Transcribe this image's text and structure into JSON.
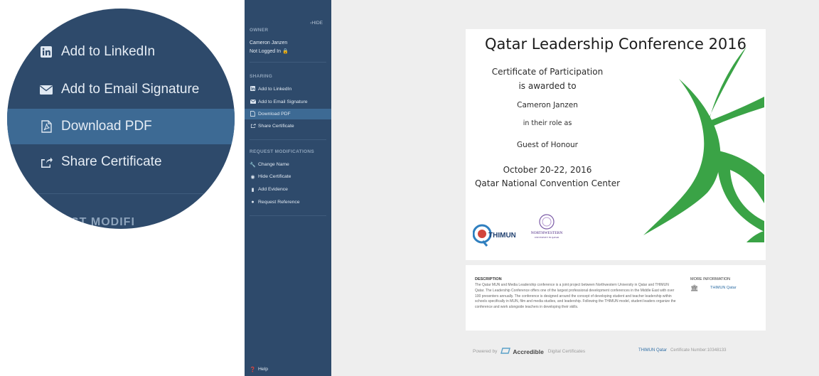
{
  "zoom": {
    "items": [
      {
        "label": "Add to LinkedIn",
        "icon": "linkedin-icon"
      },
      {
        "label": "Add to Email Signature",
        "icon": "envelope-icon"
      },
      {
        "label": "Download PDF",
        "icon": "pdf-icon",
        "active": true
      },
      {
        "label": "Share Certificate",
        "icon": "share-icon"
      }
    ],
    "cut_heading": "ST MODIFI"
  },
  "sidebar": {
    "hide_label": "HIDE",
    "owner_heading": "OWNER",
    "owner_name": "Cameron Janzen",
    "login_status": "Not Logged In",
    "sharing_heading": "SHARING",
    "sharing_items": [
      {
        "label": "Add to LinkedIn",
        "icon": "linkedin-icon"
      },
      {
        "label": "Add to Email Signature",
        "icon": "envelope-icon"
      },
      {
        "label": "Download PDF",
        "icon": "pdf-icon",
        "active": true
      },
      {
        "label": "Share Certificate",
        "icon": "share-icon"
      }
    ],
    "modifications_heading": "REQUEST MODIFICATIONS",
    "modification_items": [
      {
        "label": "Change Name",
        "icon": "wrench-icon"
      },
      {
        "label": "Hide Certificate",
        "icon": "eye-icon"
      },
      {
        "label": "Add Evidence",
        "icon": "file-icon"
      },
      {
        "label": "Request Reference",
        "icon": "comment-icon"
      }
    ],
    "help_label": "Help"
  },
  "certificate": {
    "title": "Qatar Leadership Conference 2016",
    "line1": "Certificate of Participation",
    "line2": "is awarded to",
    "recipient": "Cameron Janzen",
    "role_prefix": "in their role as",
    "role": "Guest of Honour",
    "dates": "October 20-22, 2016",
    "venue": "Qatar National Convention Center",
    "logo_left_text": "THIMUN",
    "logo_right_text": "NORTHWESTERN",
    "logo_right_sub": "UNIVERSITY IN QATAR",
    "accent_color": "#3aa346"
  },
  "description": {
    "heading": "DESCRIPTION",
    "text": "The Qatar MUN and Media Leadership conference is a joint project between Northwestern University in Qatar and THIMUN Qatar. The Leadership Conference offers one of the largest professional development conferences in the Middle East with over 100 presenters annually. The conference is designed around the concept of developing student and teacher leadership within schools specifically in MUN, film and media studies, and leadership. Following the THIMUN model, student leaders organize the conference and work alongside teachers in developing their skills.",
    "more_heading": "MORE INFORMATION",
    "more_link": "THIMUN Qatar"
  },
  "footer": {
    "powered_by": "Powered by",
    "brand": "Accredible",
    "brand_suffix": "Digital Certificates",
    "issuer": "THIMUN Qatar",
    "cert_number_label": "Certificate Number:",
    "cert_number": "10348133"
  }
}
